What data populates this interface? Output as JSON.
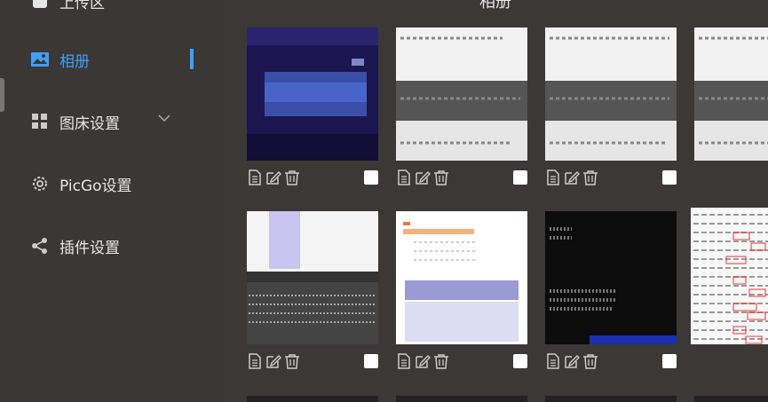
{
  "sidebar": {
    "items": [
      {
        "label": "上传区",
        "icon": "upload-icon"
      },
      {
        "label": "相册",
        "icon": "image-icon",
        "active": true
      },
      {
        "label": "图床设置",
        "icon": "grid-icon"
      },
      {
        "label": "PicGo设置",
        "icon": "gear-icon"
      },
      {
        "label": "插件设置",
        "icon": "share-icon"
      }
    ]
  },
  "main": {
    "title": "相册",
    "card_actions": [
      "copy-link-icon",
      "edit-icon",
      "delete-icon"
    ]
  },
  "colors": {
    "accent": "#409eff",
    "background": "#3a3735",
    "text": "#e6e6e6"
  }
}
